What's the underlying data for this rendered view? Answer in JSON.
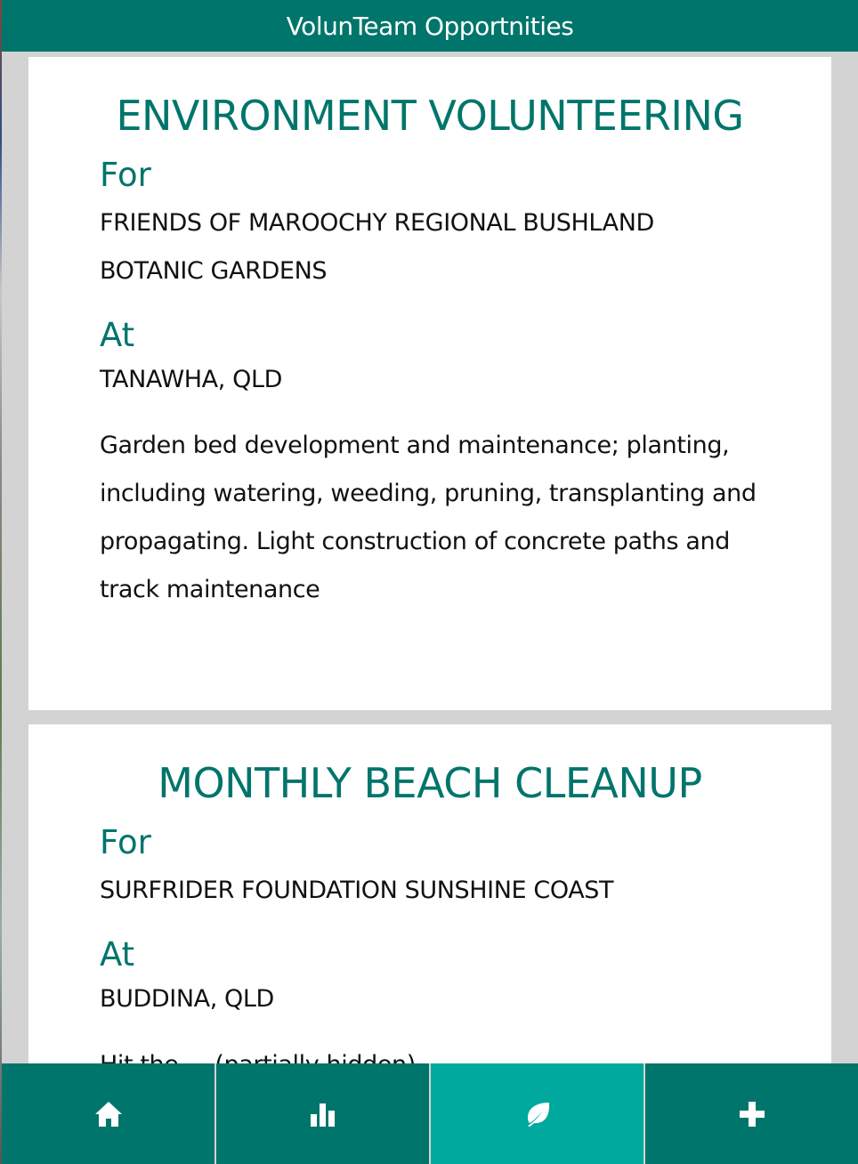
{
  "header": {
    "title": "VolunTeam Opportnities"
  },
  "opportunities": [
    {
      "title": "ENVIRONMENT VOLUNTEERING",
      "for_label": "For",
      "organisation_lines": [
        "FRIENDS OF MAROOCHY REGIONAL BUSHLAND",
        "BOTANIC GARDENS"
      ],
      "at_label": "At",
      "location": "TANAWHA, QLD",
      "description_lines": [
        "Garden bed development and maintenance; planting,",
        "including watering, weeding, pruning, transplanting and",
        "propagating. Light construction of concrete paths and",
        "track maintenance"
      ]
    },
    {
      "title": "MONTHLY BEACH CLEANUP",
      "for_label": "For",
      "organisation_lines": [
        "SURFRIDER FOUNDATION SUNSHINE COAST"
      ],
      "at_label": "At",
      "location": "BUDDINA, QLD",
      "description_lines": [
        "Hit the ... (partially hidden)"
      ]
    }
  ],
  "bottom_nav": [
    {
      "icon": "home-icon",
      "active": false
    },
    {
      "icon": "bar-chart-icon",
      "active": false
    },
    {
      "icon": "leaf-icon",
      "active": true
    },
    {
      "icon": "plus-icon",
      "active": false
    }
  ],
  "colors": {
    "primary": "#00756b",
    "active": "#00a99d",
    "background": "#d3d3d3"
  }
}
